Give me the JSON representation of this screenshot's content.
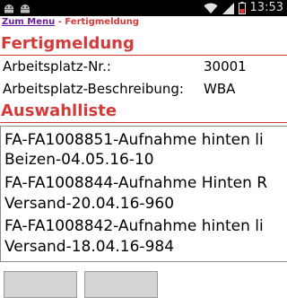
{
  "statusbar": {
    "left_icons": [
      "android-debug-icon",
      "android-debug-icon"
    ],
    "time": "13:53"
  },
  "breadcrumb": {
    "link": "Zum Menu",
    "separator": " - ",
    "current": "Fertigmeldung"
  },
  "form": {
    "title": "Fertigmeldung",
    "rows": [
      {
        "label": "Arbeitsplatz-Nr.:",
        "value": "30001"
      },
      {
        "label": "Arbeitsplatz-Beschreibung:",
        "value": "WBA"
      }
    ]
  },
  "list": {
    "title": "Auswahlliste",
    "items": [
      {
        "line1": "FA-FA1008851-Aufnahme hinten li",
        "line2": "Beizen-04.05.16-10"
      },
      {
        "line1": "FA-FA1008844-Aufnahme Hinten R",
        "line2": "Versand-20.04.16-960"
      },
      {
        "line1": "FA-FA1008842-Aufnahme hinten li",
        "line2": "Versand-18.04.16-984"
      }
    ]
  },
  "colors": {
    "accent": "#d33a3a",
    "link": "#6a1b9a",
    "statusbar": "#000000",
    "button": "#d4d4d4"
  }
}
